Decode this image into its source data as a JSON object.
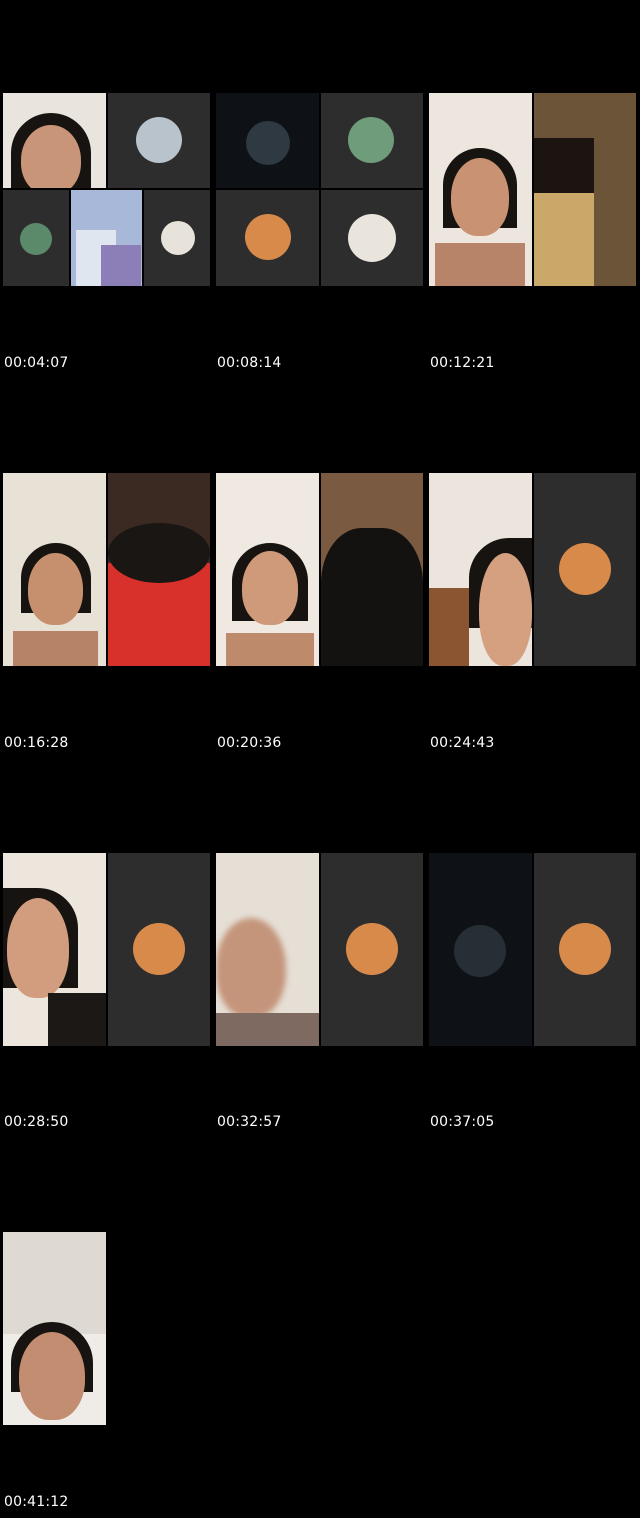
{
  "thumbnails": [
    {
      "timestamp": "00:04:07"
    },
    {
      "timestamp": "00:08:14"
    },
    {
      "timestamp": "00:12:21"
    },
    {
      "timestamp": "00:16:28"
    },
    {
      "timestamp": "00:20:36"
    },
    {
      "timestamp": "00:24:43"
    },
    {
      "timestamp": "00:28:50"
    },
    {
      "timestamp": "00:32:57"
    },
    {
      "timestamp": "00:37:05"
    },
    {
      "timestamp": "00:41:12"
    }
  ],
  "colors": {
    "background": "#000000",
    "call_tile_dark": "#2d2d2d",
    "timestamp_text": "#ffffff"
  }
}
